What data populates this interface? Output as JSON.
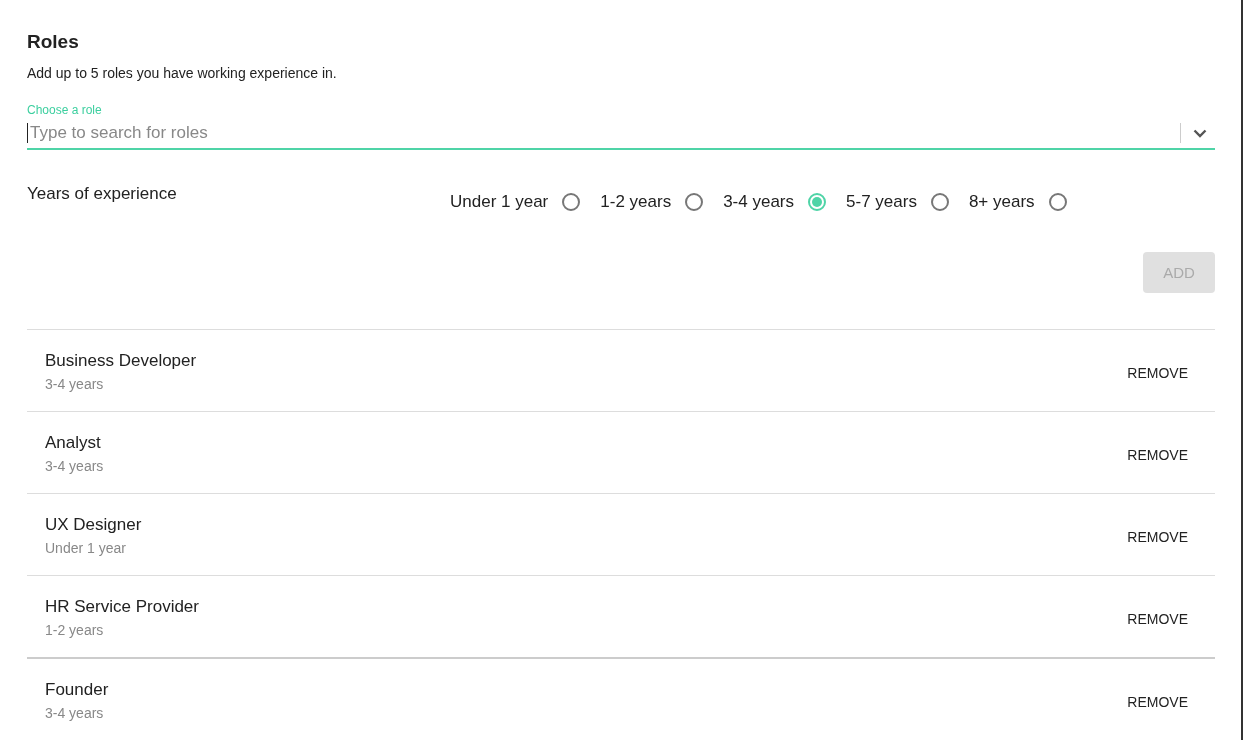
{
  "heading": "Roles",
  "subtitle": "Add up to 5 roles you have working experience in.",
  "role_field": {
    "label": "Choose a role",
    "placeholder": "Type to search for roles"
  },
  "experience": {
    "label": "Years of experience",
    "options": [
      {
        "label": "Under 1 year",
        "selected": false
      },
      {
        "label": "1-2 years",
        "selected": false
      },
      {
        "label": "3-4 years",
        "selected": true
      },
      {
        "label": "5-7 years",
        "selected": false
      },
      {
        "label": "8+ years",
        "selected": false
      }
    ]
  },
  "add_button": {
    "label": "ADD",
    "disabled": true
  },
  "roles": [
    {
      "name": "Business Developer",
      "years": "3-4 years",
      "action": "REMOVE"
    },
    {
      "name": "Analyst",
      "years": "3-4 years",
      "action": "REMOVE"
    },
    {
      "name": "UX Designer",
      "years": "Under 1 year",
      "action": "REMOVE"
    },
    {
      "name": "HR Service Provider",
      "years": "1-2 years",
      "action": "REMOVE"
    },
    {
      "name": "Founder",
      "years": "3-4 years",
      "action": "REMOVE"
    }
  ]
}
